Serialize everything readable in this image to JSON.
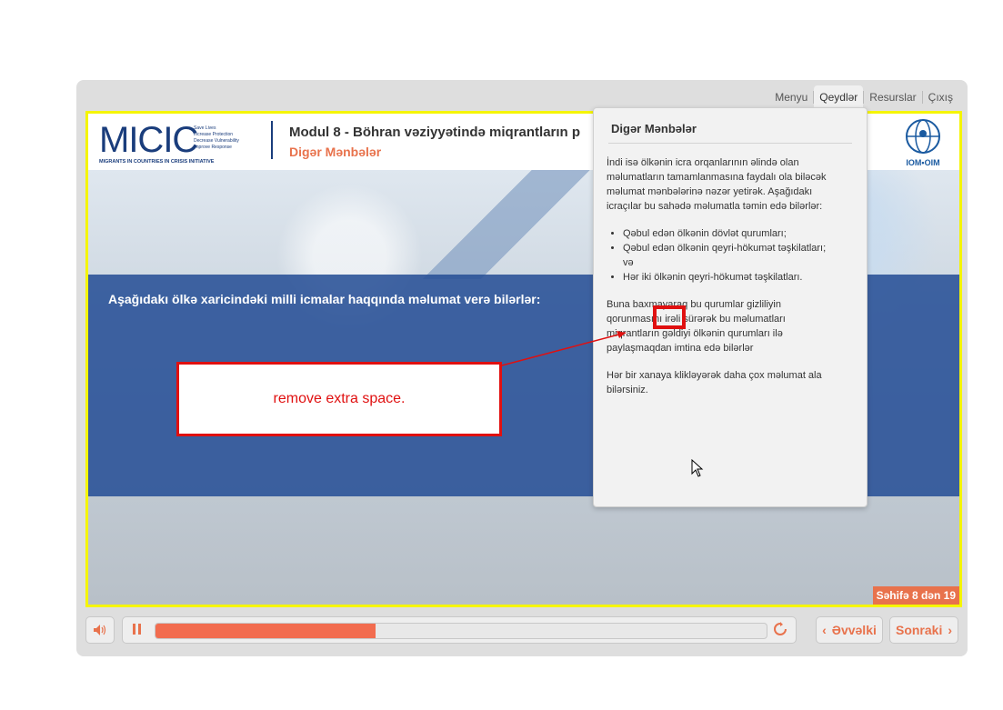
{
  "nav": {
    "menu": "Menyu",
    "notes": "Qeydlər",
    "resources": "Resurslar",
    "exit": "Çıxış"
  },
  "header": {
    "logo_text": "MICIC",
    "logo_lines": [
      "Save Lives",
      "Increase Protection",
      "Decrease Vulnerability",
      "Improve Response"
    ],
    "logo_sub": "MIGRANTS IN COUNTRIES IN CRISIS INITIATIVE",
    "module_title": "Modul 8 - Böhran vəziyyətində miqrantların p",
    "module_subtitle": "Digər Mənbələr",
    "iom_label": "IOM•OIM"
  },
  "slide": {
    "band_text": "Aşağıdakı ölkə xaricindəki milli icmalar haqqında məlumat verə bilərlər:",
    "page_indicator": "Səhifə 8 dən 19"
  },
  "notes": {
    "title": "Digər Mənbələr",
    "p1": "İndi isə ölkənin icra orqanlarının əlində olan məlumatların tamamlanmasına faydalı ola biləcək məlumat mənbələrinə nəzər yetirək. Aşağıdakı icraçılar bu sahədə məlumatla təmin edə bilərlər:",
    "bullets": [
      "Qəbul edən ölkənin dövlət qurumları;",
      "Qəbul edən ölkənin qeyri-hökumət təşkilatları; və",
      "Hər iki ölkənin qeyri-hökumət təşkilatları."
    ],
    "p2": "Buna baxmayaraq bu qurumlar gizliliyin qorunmasını irəli sürərək bu məlumatları miqrantların gəldiyi ölkənin qurumları ilə paylaşmaqdan imtina edə bilərlər",
    "p3": "Hər bir xanaya klikləyərək daha çox məlumat ala bilərsiniz."
  },
  "annotation": {
    "callout_text": "remove extra space."
  },
  "controls": {
    "progress": 0.36,
    "prev_label": "Əvvəlki",
    "next_label": "Sonraki"
  },
  "colors": {
    "accent": "#e8724c",
    "band": "#28509a",
    "highlight": "#e01010",
    "frame": "#f5f500"
  }
}
